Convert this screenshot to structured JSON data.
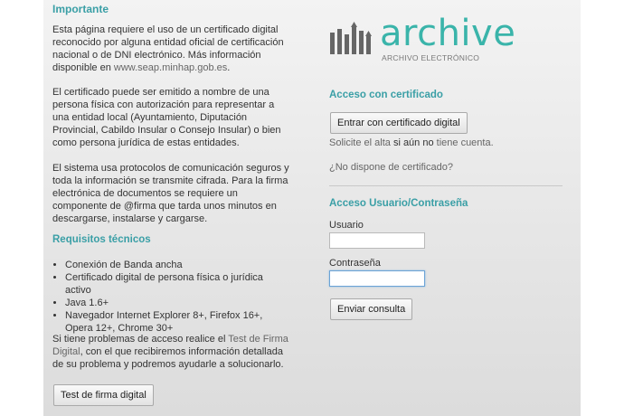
{
  "left": {
    "important_heading": "Importante",
    "para1": "Esta página requiere el uso de un certificado digital reconocido por alguna entidad oficial de certificación nacional o de DNI electrónico. Más información disponible en",
    "para1_link": "www.seap.minhap.gob.es",
    "para1_end": ".",
    "para2": "El certificado puede ser emitido a nombre de una persona física con autorización para representar a una entidad local (Ayuntamiento, Diputación Provincial, Cabildo Insular o Consejo Insular) o bien como persona jurídica de estas entidades.",
    "para3": "El sistema usa protocolos de comunicación seguros y toda la información se transmite cifrada. Para la firma electrónica de documentos se requiere un componente de @firma que tarda unos minutos en descargarse, instalarse y cargarse.",
    "requirements_heading": "Requisitos técnicos",
    "requirements": [
      "Conexión de Banda ancha",
      "Certificado digital de persona física o jurídica activo",
      "Java 1.6+",
      "Navegador Internet Explorer 8+, Firefox 16+, Opera 12+, Chrome 30+"
    ],
    "problems_start": "Si tiene problemas de acceso realice el",
    "problems_link": "Test de Firma Digital",
    "problems_end": ", con el que recibiremos información detallada de su problema y podremos ayudarle a solucionarlo.",
    "test_button": "Test de firma digital"
  },
  "right": {
    "logo_word": "archive",
    "logo_sub": "ARCHIVO ELECTRÓNICO",
    "cert_heading": "Acceso con certificado",
    "cert_button": "Entrar con certificado digital",
    "register_start": "Solicite el alta",
    "register_bold": "si aún no",
    "register_end": "tiene cuenta.",
    "no_cert_link": "¿No dispone de certificado?",
    "user_heading": "Acceso Usuario/Contraseña",
    "user_label": "Usuario",
    "user_value": "",
    "password_label": "Contraseña",
    "password_value": "",
    "submit_button": "Enviar consulta"
  },
  "colors": {
    "accent": "#3a9fa6",
    "logo": "#3ab4aa"
  }
}
